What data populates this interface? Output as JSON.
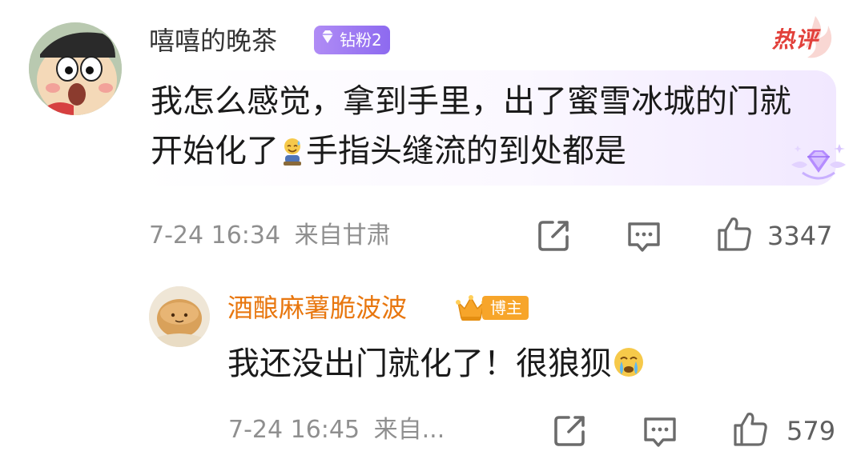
{
  "comment": {
    "username": "嘻嘻的晚茶",
    "fan_badge": "钻粉2",
    "hot_label": "热评",
    "text_part1": "我怎么感觉，拿到手里，出了蜜雪冰城的门就开始化了",
    "text_part2": "手指头缝流的到处都是",
    "timestamp": "7-24 16:34",
    "location": "来自甘肃",
    "like_count": "3347"
  },
  "reply": {
    "username": "酒酿麻薯脆波波",
    "badge_label": "博主",
    "text": "我还没出门就化了！很狼狈",
    "timestamp": "7-24 16:45",
    "location": "来自...",
    "like_count": "579"
  },
  "icons": {
    "share": "share-icon",
    "comment": "comment-icon",
    "like": "thumbs-up-icon",
    "fan_badge": "diamond-icon",
    "blogger": "crown-icon"
  },
  "colors": {
    "username": "#333333",
    "reply_username": "#e8770f",
    "hot_label": "#e2403a",
    "fan_badge": "#9b7cf3",
    "blogger_badge": "#f7a52a",
    "meta_text": "#8f8f8f"
  }
}
